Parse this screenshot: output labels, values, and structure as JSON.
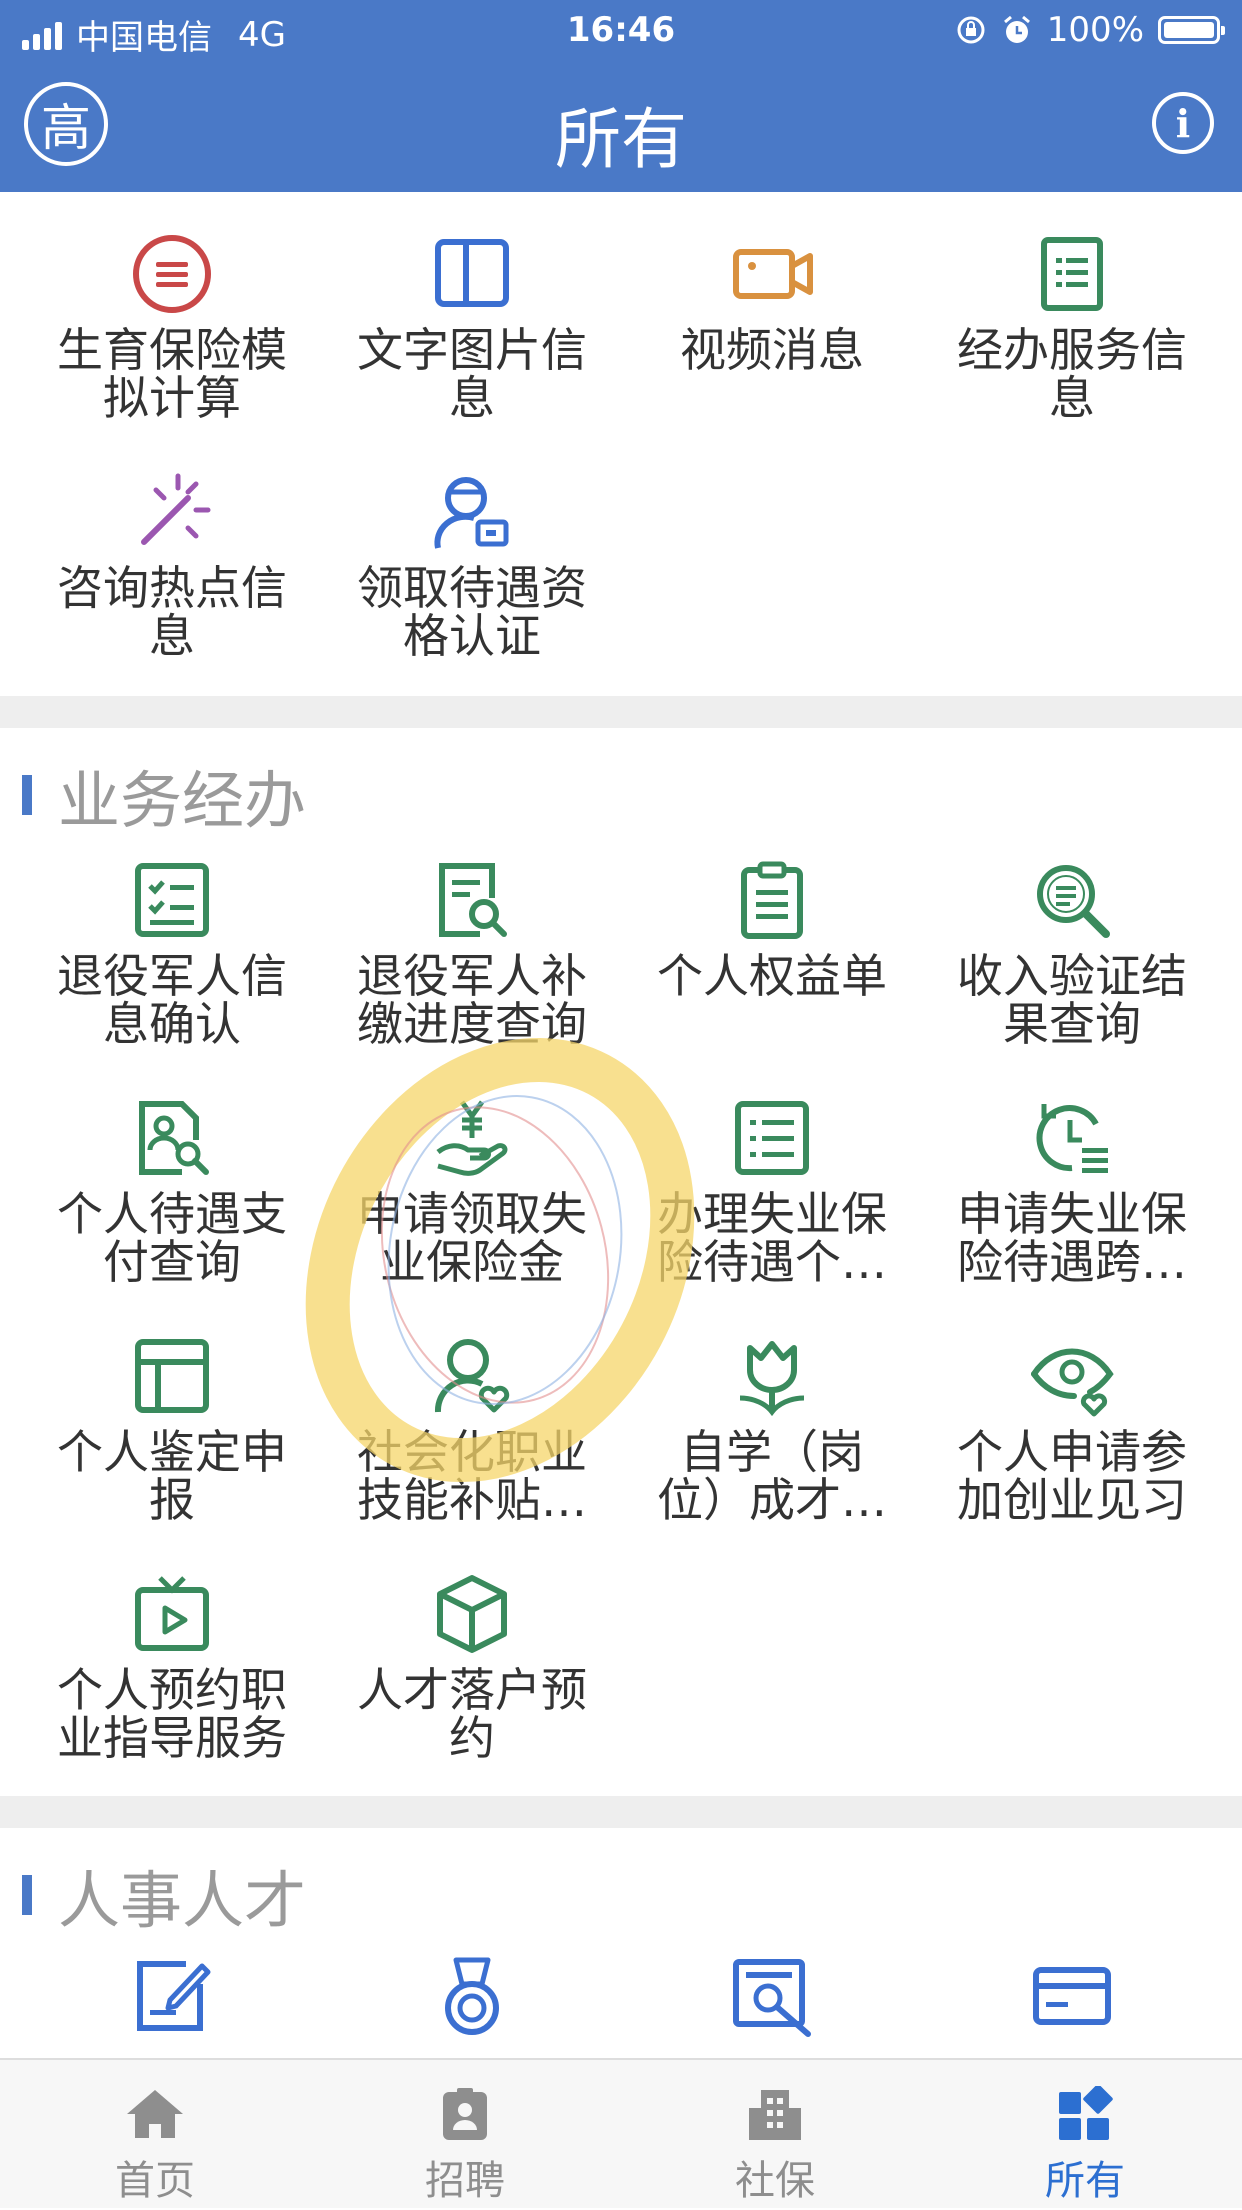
{
  "status_bar": {
    "carrier": "中国电信",
    "network": "4G",
    "time": "16:46",
    "battery": "100%"
  },
  "nav": {
    "avatar_text": "高",
    "title": "所有",
    "info_icon": "info-icon"
  },
  "colors": {
    "brand": "#4a79c7",
    "green": "#3a8a5d",
    "red": "#c94848",
    "orange": "#d9913f",
    "purple": "#9b57b0",
    "blue": "#3b6fd1",
    "tab_active": "#2c6fd1"
  },
  "top_items": [
    {
      "label": "生育保险模\n拟计算",
      "icon": "list-circle-icon"
    },
    {
      "label": "文字图片信\n息",
      "icon": "book-icon"
    },
    {
      "label": "视频消息",
      "icon": "video-icon"
    },
    {
      "label": "经办服务信\n息",
      "icon": "document-list-icon"
    },
    {
      "label": "咨询热点信\n息",
      "icon": "sparkle-icon"
    },
    {
      "label": "领取待遇资\n格认证",
      "icon": "person-id-icon"
    }
  ],
  "sections": [
    {
      "title": "业务经办",
      "items": [
        {
          "label": "退役军人信\n息确认",
          "icon": "checklist-icon"
        },
        {
          "label": "退役军人补\n缴进度查询",
          "icon": "document-search-icon"
        },
        {
          "label": "个人权益单",
          "icon": "clipboard-icon"
        },
        {
          "label": "收入验证结\n果查询",
          "icon": "magnifier-icon"
        },
        {
          "label": "个人待遇支\n付查询",
          "icon": "person-search-icon"
        },
        {
          "label": "申请领取失\n业保险金",
          "icon": "yen-hand-icon"
        },
        {
          "label": "办理失业保\n险待遇个…",
          "icon": "list-icon"
        },
        {
          "label": "申请失业保\n险待遇跨…",
          "icon": "clock-list-icon"
        },
        {
          "label": "个人鉴定申\n报",
          "icon": "layout-icon"
        },
        {
          "label": "社会化职业\n技能补贴…",
          "icon": "person-heart-icon"
        },
        {
          "label": "自学（岗\n位）成才…",
          "icon": "tulip-icon"
        },
        {
          "label": "个人申请参\n加创业见习",
          "icon": "eye-heart-icon"
        },
        {
          "label": "个人预约职\n业指导服务",
          "icon": "tv-play-icon"
        },
        {
          "label": "人才落户预\n约",
          "icon": "cube-icon"
        }
      ]
    },
    {
      "title": "人事人才",
      "items": [
        {
          "label": "",
          "icon": "edit-icon"
        },
        {
          "label": "",
          "icon": "medal-icon"
        },
        {
          "label": "",
          "icon": "newspaper-search-icon"
        },
        {
          "label": "",
          "icon": "card-icon"
        }
      ]
    }
  ],
  "tabs": [
    {
      "label": "首页",
      "icon": "home-icon",
      "active": false
    },
    {
      "label": "招聘",
      "icon": "badge-person-icon",
      "active": false
    },
    {
      "label": "社保",
      "icon": "building-icon",
      "active": false
    },
    {
      "label": "所有",
      "icon": "grid-icon",
      "active": true
    }
  ]
}
